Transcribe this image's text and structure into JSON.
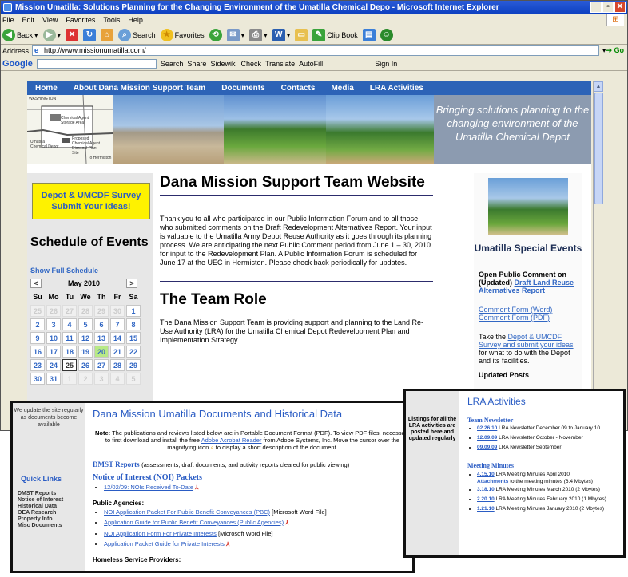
{
  "window": {
    "title": "Mission Umatilla: Solutions Planning for the Changing Environment of the Umatilla Chemical Depo - Microsoft Internet Explorer",
    "menu": [
      "File",
      "Edit",
      "View",
      "Favorites",
      "Tools",
      "Help"
    ],
    "toolbar": {
      "back": "Back",
      "search": "Search",
      "favorites": "Favorites",
      "clipbook": "Clip Book"
    },
    "address_label": "Address",
    "address_value": "http://www.missionumatilla.com/",
    "go": "Go",
    "google": {
      "logo": "Google",
      "items": [
        "Search",
        "Share",
        "Sidewiki",
        "Check",
        "Translate",
        "AutoFill"
      ],
      "sign_in": "Sign In"
    }
  },
  "site": {
    "nav": [
      "Home",
      "About Dana Mission Support Team",
      "Documents",
      "Contacts",
      "Media",
      "LRA Activities"
    ],
    "banner_tagline": "Bringing solutions planning to the changing environment of the Umatilla Chemical Depot",
    "map_labels": [
      "WASHINGTON",
      "Chemical Agent Storage Area",
      "Proposed Chemical Agent Disposal Plant Site",
      "Umatilla Chemical Depot",
      "To Hermiston"
    ],
    "survey_button": "Depot & UMCDF Survey Submit Your Ideas!",
    "schedule_title": "Schedule of Events",
    "schedule_link": "Show Full Schedule",
    "calendar": {
      "month": "May 2010",
      "weekdays": [
        "Su",
        "Mo",
        "Tu",
        "We",
        "Th",
        "Fr",
        "Sa"
      ],
      "weeks": [
        [
          "25",
          "26",
          "27",
          "28",
          "29",
          "30",
          "1"
        ],
        [
          "2",
          "3",
          "4",
          "5",
          "6",
          "7",
          "8"
        ],
        [
          "9",
          "10",
          "11",
          "12",
          "13",
          "14",
          "15"
        ],
        [
          "16",
          "17",
          "18",
          "19",
          "20",
          "21",
          "22"
        ],
        [
          "23",
          "24",
          "25",
          "26",
          "27",
          "28",
          "29"
        ],
        [
          "30",
          "31",
          "1",
          "2",
          "3",
          "4",
          "5"
        ]
      ]
    },
    "main_title": "Dana Mission Support Team Website",
    "main_para": "Thank you to all who participated in our Public Information Forum and to all those who submitted comments on the Draft Redevelopment Alternatives Report. Your input is valuable to the Umatilla Army Depot Reuse Authority as it goes through its planning process. We are anticipating the next Public Comment period from June 1 – 30, 2010 for input to the Redevelopment Plan. A Public Information Forum is scheduled for June 17 at the UEC in Hermiston. Please check back periodically for updates.",
    "role_title": "The Team Role",
    "role_para": "The Dana Mission Support Team is providing support and planning to the Land Re-Use Authority (LRA) for the Umatilla Chemical Depot Redevelopment Plan and Implementation Strategy.",
    "right": {
      "title": "Umatilla Special Events",
      "open_comment": "Open Public Comment on (Updated)",
      "draft_link": "Draft Land Reuse Alternatives Report",
      "form_word": "Comment Form (Word)",
      "form_pdf": "Comment Form (PDF)",
      "take_pre": "Take the",
      "survey_link": "Depot & UMCDF Survey and submit your ideas",
      "take_post": "for what to do with the Depot and its facilities.",
      "updated_posts": "Updated Posts"
    }
  },
  "docs": {
    "side_note": "We update the site regularly as documents become available",
    "quick_links": "Quick Links",
    "quick_list": [
      "DMST Reports",
      "Notice of Interest",
      "Historical Data",
      "OEA Research",
      "Property Info",
      "Misc Documents"
    ],
    "title": "Dana Mission Umatilla Documents and Historical Data",
    "note_label": "Note:",
    "note_a": "The publications and reviews listed below are in Portable Document Format (PDF). To view PDF files, necessary to first download and install the free",
    "note_link": "Adobe Acrobat Reader",
    "note_b": "from Adobe Systems, Inc. Move the cursor over the magnifying icon",
    "note_c": "to display a short description of the document.",
    "dmst_link": "DMST Reports",
    "dmst_desc": "(assessments, draft documents, and activity reports cleared for public viewing)",
    "noi_title": "Notice of Interest (NOI) Packets",
    "noi_item": "12/02/09: NOIs Received To-Date",
    "public_agencies": "Public Agencies:",
    "agency_items": [
      {
        "link": "NOI Application Packet For Public Benefit Conveyances (PBC)",
        "tail": "[Microsoft Word File]"
      },
      {
        "link": "Application Guide for Public Benefit Conveyances (Public Agencies)",
        "tail": ""
      },
      {
        "link": "NOI Application Form For Private Interests",
        "tail": "[Microsoft Word File]"
      },
      {
        "link": "Application Packet Guide for Private Interests",
        "tail": ""
      }
    ],
    "homeless": "Homeless Service Providers:"
  },
  "lra": {
    "side": "Listings for all the LRA activities are posted here and updated regularly",
    "title": "LRA Activities",
    "newsletter_title": "Team Newsletter",
    "newsletters": [
      {
        "date": "02.26.10",
        "text": "LRA Newsletter December 09 to January 10"
      },
      {
        "date": "12.09.09",
        "text": "LRA Newsletter October - November"
      },
      {
        "date": "09.09.09",
        "text": "LRA Newsletter September"
      }
    ],
    "minutes_title": "Meeting Minutes",
    "minutes": [
      {
        "date": "4.15.10",
        "text": "LRA Meeting Minutes April 2010"
      },
      {
        "date": "3.18.10",
        "text": "LRA Meeting Minutes March 2010 (2 Mbytes)"
      },
      {
        "date": "2.20.10",
        "text": "LRA Meeting Minutes February 2010 (1 Mbytes)"
      },
      {
        "date": "1.21.10",
        "text": "LRA Meeting Minutes January 2010 (2 Mbytes)"
      }
    ],
    "attachments_link": "Attachments",
    "attachments_text": "to the meeting minutes (6.4 Mbytes)"
  }
}
